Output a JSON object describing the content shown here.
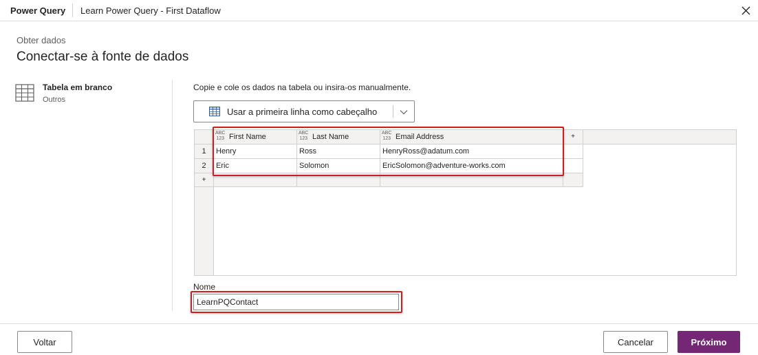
{
  "titlebar": {
    "app_name": "Power Query",
    "doc_title": "Learn Power Query - First Dataflow"
  },
  "breadcrumb": "Obter dados",
  "page_title": "Conectar-se à fonte de dados",
  "source": {
    "name": "Tabela em branco",
    "category": "Outros",
    "icon": "table-icon"
  },
  "instruction": "Copie e cole os dados na tabela ou insira-os manualmente.",
  "header_button": {
    "label": "Usar a primeira linha como cabeçalho"
  },
  "table": {
    "type_badge_top": "ABC",
    "type_badge_bottom": "123",
    "columns": [
      "First Name",
      "Last Name",
      "Email Address"
    ],
    "rows": [
      {
        "num": "1",
        "cells": [
          "Henry",
          "Ross",
          "HenryRoss@adatum.com"
        ]
      },
      {
        "num": "2",
        "cells": [
          "Eric",
          "Solomon",
          "EricSolomon@adventure-works.com"
        ]
      }
    ],
    "add_symbol": "+"
  },
  "name_field": {
    "label": "Nome",
    "value": "LearnPQContact"
  },
  "footer": {
    "back_label": "Voltar",
    "cancel_label": "Cancelar",
    "next_label": "Próximo"
  },
  "colors": {
    "accent": "#742774",
    "highlight": "#d01c1c"
  }
}
